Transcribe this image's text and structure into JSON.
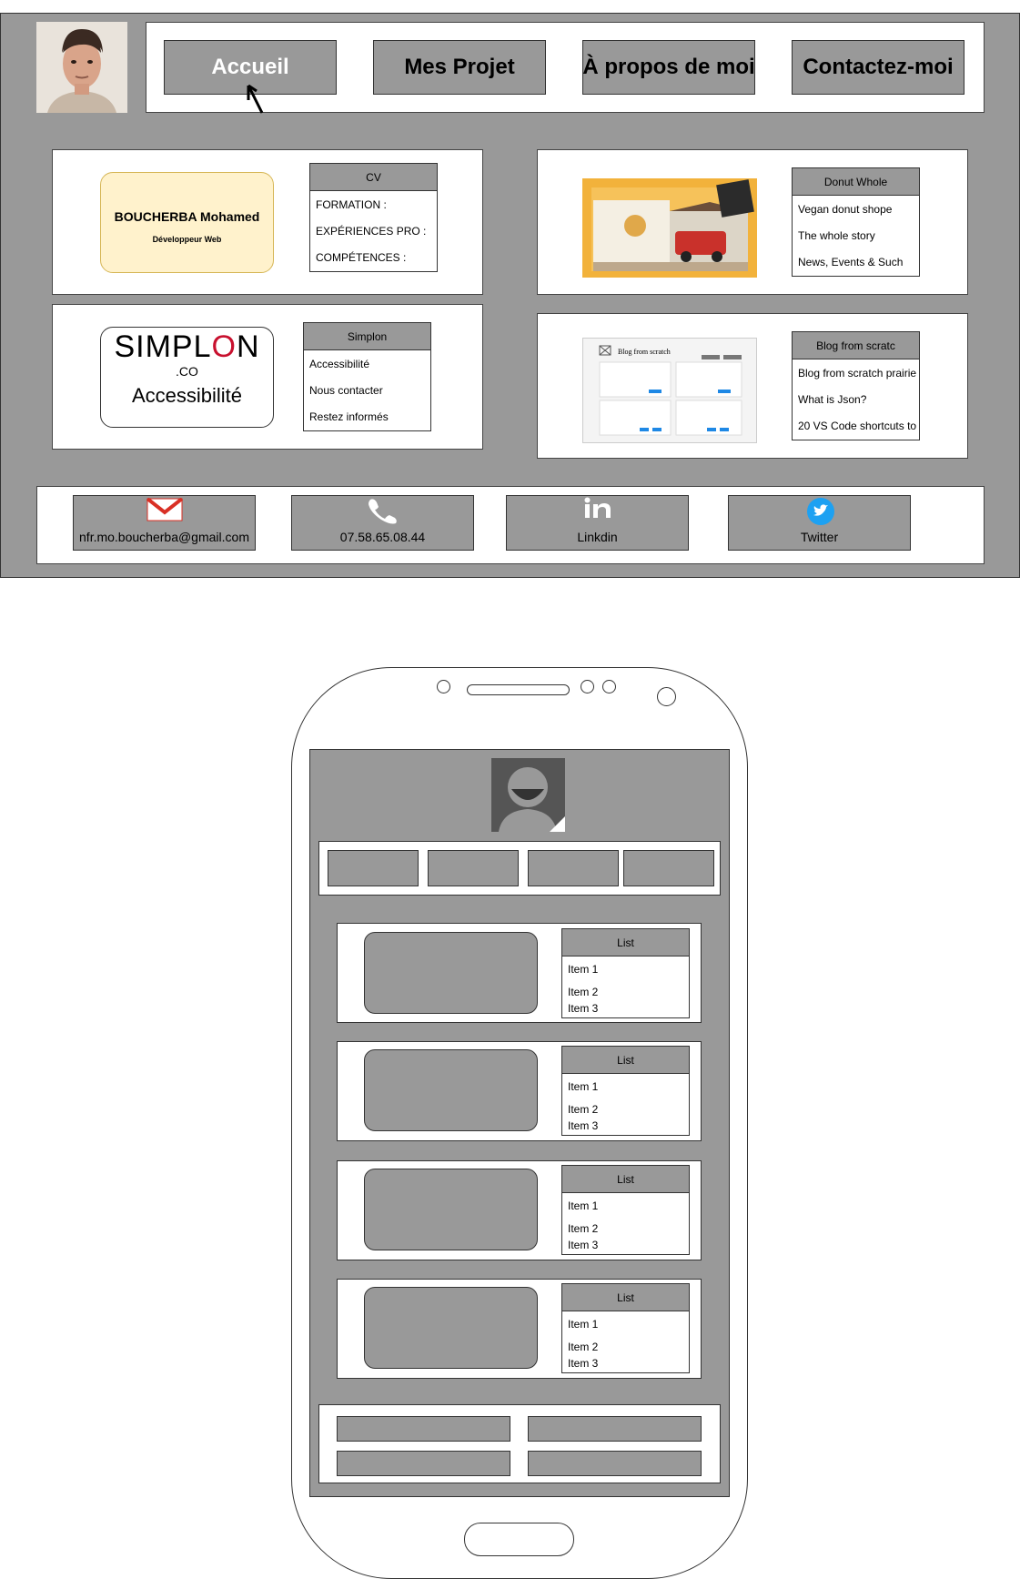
{
  "nav": {
    "home": "Accueil",
    "projects": "Mes Projet",
    "about": "À propos de moi",
    "contact": "Contactez-moi"
  },
  "profile_card": {
    "name": "BOUCHERBA Mohamed",
    "role": "Développeur Web",
    "list_title": "CV",
    "items": [
      "FORMATION :",
      "EXPÉRIENCES PRO :",
      "COMPÉTENCES :"
    ]
  },
  "simplon_card": {
    "logo_main": "SIMPL",
    "logo_o": "O",
    "logo_n": "N",
    "logo_sub": ".CO",
    "subtitle": "Accessibilité",
    "list_title": "Simplon",
    "items": [
      "Accessibilité",
      "Nous contacter",
      "Restez informés"
    ]
  },
  "donut_card": {
    "list_title": "Donut Whole",
    "items": [
      "Vegan donut shope",
      "The whole story",
      "News, Events & Such"
    ]
  },
  "blog_card": {
    "thumb_title": "Blog from scratch",
    "list_title": "Blog from scratc",
    "items": [
      "Blog from scratch prairie",
      "What is Json?",
      "20 VS Code shortcuts to"
    ]
  },
  "footer": {
    "email": "nfr.mo.boucherba@gmail.com",
    "phone": "07.58.65.08.44",
    "linkedin": "Linkdin",
    "twitter": "Twitter"
  },
  "mobile": {
    "lists": [
      {
        "title": "List",
        "items": [
          "Item 1",
          "Item 2",
          "Item 3"
        ]
      },
      {
        "title": "List",
        "items": [
          "Item 1",
          "Item 2",
          "Item 3"
        ]
      },
      {
        "title": "List",
        "items": [
          "Item 1",
          "Item 2",
          "Item 3"
        ]
      },
      {
        "title": "List",
        "items": [
          "Item 1",
          "Item 2",
          "Item 3"
        ]
      }
    ]
  },
  "colors": {
    "panel_gray": "#999999",
    "profile_yellow": "#fff2cc",
    "simplon_red": "#c8102e",
    "twitter_blue": "#1da1f2",
    "gmail_red": "#d93025"
  }
}
